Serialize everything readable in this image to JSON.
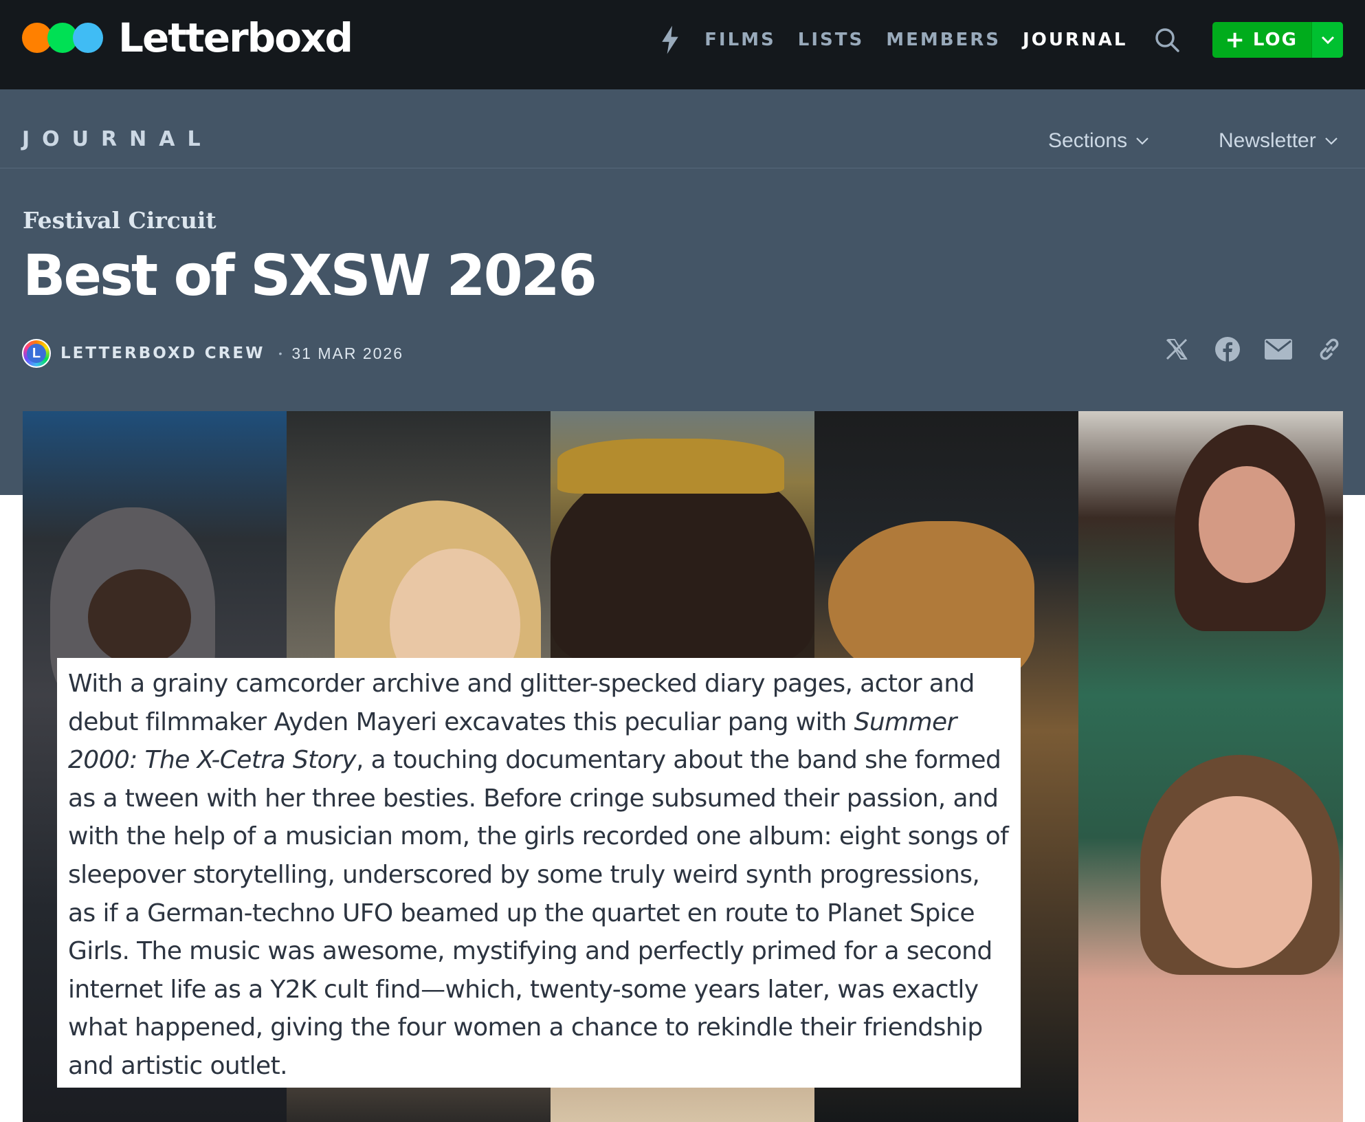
{
  "brand": {
    "name": "Letterboxd",
    "colors": {
      "orange": "#ff8000",
      "green": "#00e054",
      "blue": "#40bcf4"
    }
  },
  "nav": {
    "activity_icon": "lightning-bolt-icon",
    "links": [
      "FILMS",
      "LISTS",
      "MEMBERS",
      "JOURNAL"
    ],
    "active": "JOURNAL",
    "search_icon": "search-icon",
    "log_button": "LOG",
    "log_button_color": "#00ac1c"
  },
  "journal": {
    "label": "JOURNAL",
    "menus": [
      "Sections",
      "Newsletter"
    ]
  },
  "article": {
    "kicker": "Festival Circuit",
    "title": "Best of SXSW 2026",
    "avatar_letter": "L",
    "author": "LETTERBOXD CREW",
    "separator": "•",
    "date": "31 MAR 2026",
    "share_icons": [
      "x-icon",
      "facebook-icon",
      "email-icon",
      "link-icon"
    ]
  },
  "blurb": {
    "before_italic": "With a grainy camcorder archive and glitter-specked diary pages, actor and debut filmmaker Ayden Mayeri excavates this peculiar pang with ",
    "italic": "Summer 2000: The X-Cetra Story",
    "after_italic": ", a touching documentary about the band she formed as a tween with her three besties. Before cringe subsumed their passion, and with the help of a musician mom, the girls recorded one album: eight songs of sleepover storytelling, underscored by some truly weird synth progressions, as if a German-techno UFO beamed up the quartet en route to Planet Spice Girls. The music was awesome, mystifying and perfectly primed for a second internet life as a Y2K cult find—which, twenty-some years later, was exactly what happened, giving the four women a chance to rekindle their friendship and artistic outlet."
  }
}
